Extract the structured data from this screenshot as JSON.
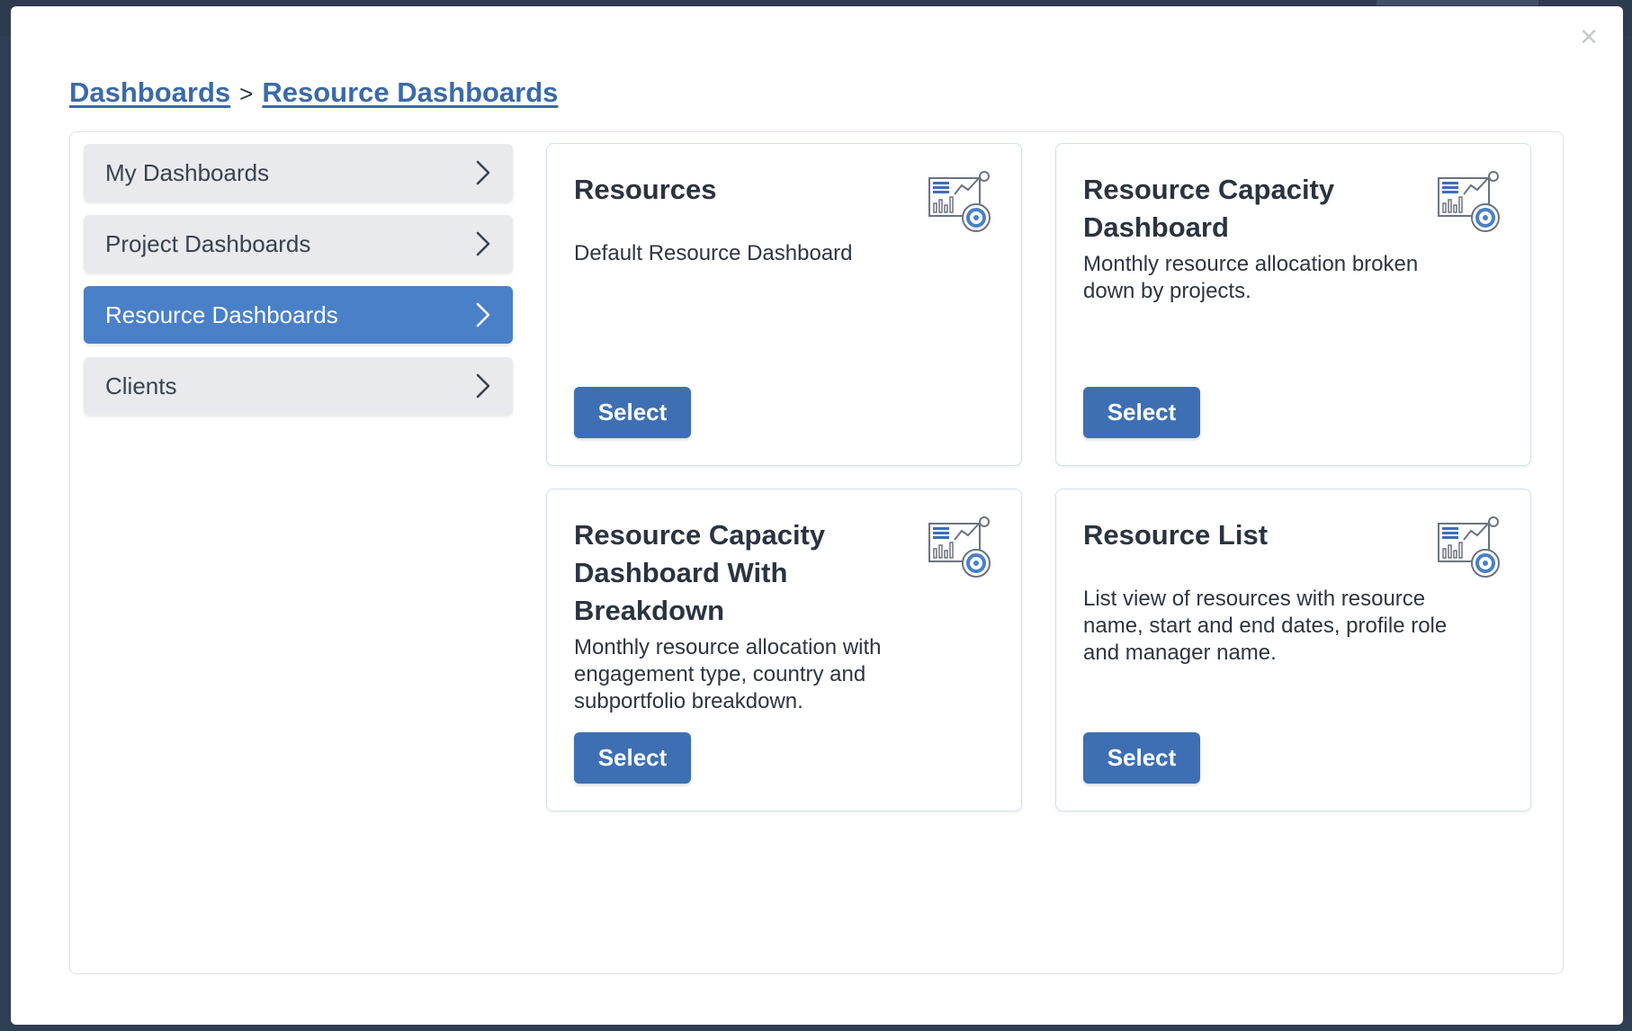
{
  "breadcrumb": {
    "root": "Dashboards",
    "separator": ">",
    "current": "Resource Dashboards"
  },
  "close": {
    "icon": "close-icon",
    "glyph": "×"
  },
  "sidebar": {
    "items": [
      {
        "label": "My Dashboards",
        "active": false
      },
      {
        "label": "Project Dashboards",
        "active": false
      },
      {
        "label": "Resource Dashboards",
        "active": true
      },
      {
        "label": "Clients",
        "active": false
      }
    ]
  },
  "cards": [
    {
      "title": "Resources",
      "description": "Default Resource Dashboard",
      "button": "Select",
      "icon": "dashboard-analytics-icon"
    },
    {
      "title": "Resource Capacity Dashboard",
      "description": "Monthly resource allocation broken down by projects.",
      "button": "Select",
      "icon": "dashboard-analytics-icon"
    },
    {
      "title": "Resource Capacity Dashboard With Breakdown",
      "description": "Monthly resource allocation with engagement type, country and subportfolio breakdown.",
      "button": "Select",
      "icon": "dashboard-analytics-icon"
    },
    {
      "title": "Resource List",
      "description": "List view of resources with resource name, start and end dates, profile role and manager name.",
      "button": "Select",
      "icon": "dashboard-analytics-icon"
    }
  ],
  "colors": {
    "accent": "#4a80c8",
    "button": "#3d6fb2",
    "link": "#3b6aa8"
  }
}
